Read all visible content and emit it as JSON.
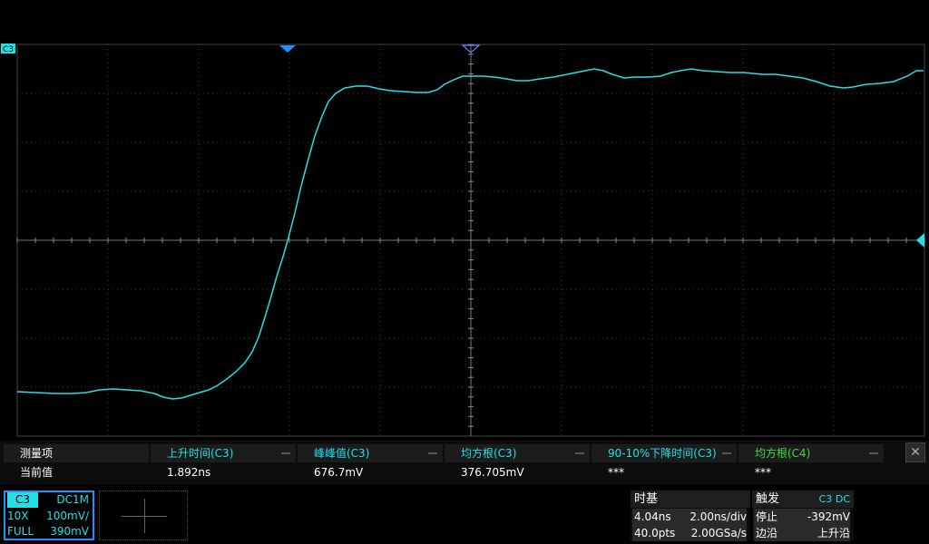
{
  "colors": {
    "trace": "#22e0e6",
    "trigger_marker": "#1e90ff",
    "grid": "#3a3a3a"
  },
  "scope": {
    "channel_marker": "C3",
    "waveform": [
      [
        19,
        432
      ],
      [
        40,
        433
      ],
      [
        60,
        434
      ],
      [
        80,
        434
      ],
      [
        95,
        433
      ],
      [
        110,
        430
      ],
      [
        125,
        429
      ],
      [
        140,
        430
      ],
      [
        155,
        431
      ],
      [
        170,
        434
      ],
      [
        180,
        438
      ],
      [
        190,
        440
      ],
      [
        200,
        439
      ],
      [
        210,
        436
      ],
      [
        220,
        433
      ],
      [
        230,
        430
      ],
      [
        240,
        425
      ],
      [
        250,
        418
      ],
      [
        260,
        410
      ],
      [
        270,
        400
      ],
      [
        278,
        388
      ],
      [
        285,
        372
      ],
      [
        292,
        350
      ],
      [
        298,
        330
      ],
      [
        305,
        305
      ],
      [
        312,
        283
      ],
      [
        318,
        262
      ],
      [
        325,
        235
      ],
      [
        332,
        205
      ],
      [
        340,
        175
      ],
      [
        347,
        150
      ],
      [
        355,
        128
      ],
      [
        362,
        112
      ],
      [
        370,
        103
      ],
      [
        380,
        97
      ],
      [
        392,
        95
      ],
      [
        405,
        95
      ],
      [
        418,
        98
      ],
      [
        430,
        100
      ],
      [
        445,
        101
      ],
      [
        460,
        102
      ],
      [
        472,
        102
      ],
      [
        482,
        99
      ],
      [
        490,
        93
      ],
      [
        500,
        88
      ],
      [
        510,
        84
      ],
      [
        520,
        84
      ],
      [
        532,
        84
      ],
      [
        545,
        85
      ],
      [
        558,
        87
      ],
      [
        570,
        89
      ],
      [
        582,
        89
      ],
      [
        595,
        87
      ],
      [
        610,
        85
      ],
      [
        625,
        82
      ],
      [
        640,
        79
      ],
      [
        655,
        76
      ],
      [
        665,
        78
      ],
      [
        675,
        82
      ],
      [
        688,
        86
      ],
      [
        700,
        85
      ],
      [
        715,
        85
      ],
      [
        728,
        84
      ],
      [
        740,
        80
      ],
      [
        750,
        78
      ],
      [
        762,
        76
      ],
      [
        775,
        78
      ],
      [
        790,
        79
      ],
      [
        805,
        80
      ],
      [
        820,
        80
      ],
      [
        840,
        82
      ],
      [
        855,
        82
      ],
      [
        870,
        84
      ],
      [
        885,
        86
      ],
      [
        900,
        90
      ],
      [
        915,
        95
      ],
      [
        930,
        97
      ],
      [
        940,
        96
      ],
      [
        955,
        93
      ],
      [
        970,
        92
      ],
      [
        985,
        90
      ],
      [
        1000,
        84
      ],
      [
        1010,
        78
      ],
      [
        1018,
        78
      ]
    ]
  },
  "measure": {
    "row_label_header": "测量项",
    "row_label_value": "当前值",
    "items": [
      {
        "name": "上升时间(C3)",
        "value": "1.892ns",
        "color": "#22e0e6"
      },
      {
        "name": "峰峰值(C3)",
        "value": "676.7mV",
        "color": "#22e0e6"
      },
      {
        "name": "均方根(C3)",
        "value": "376.705mV",
        "color": "#22e0e6"
      },
      {
        "name": "90-10%下降时间(C3)",
        "value": "***",
        "color": "#22e0e6"
      },
      {
        "name": "均方根(C4)",
        "value": "***",
        "color": "#3ddc3d"
      }
    ],
    "close": "✕"
  },
  "channel": {
    "name": "C3",
    "coupling": "DC1M",
    "probe": "10X",
    "scale": "100mV/",
    "bandwidth": "FULL",
    "offset": "390mV"
  },
  "timebase": {
    "title": "时基",
    "delay": "4.04ns",
    "scale": "2.00ns/div",
    "points": "40.0pts",
    "rate": "2.00GSa/s"
  },
  "trigger": {
    "title": "触发",
    "source": "C3 DC",
    "state_label": "停止",
    "level": "-392mV",
    "type_label": "边沿",
    "slope": "上升沿"
  }
}
